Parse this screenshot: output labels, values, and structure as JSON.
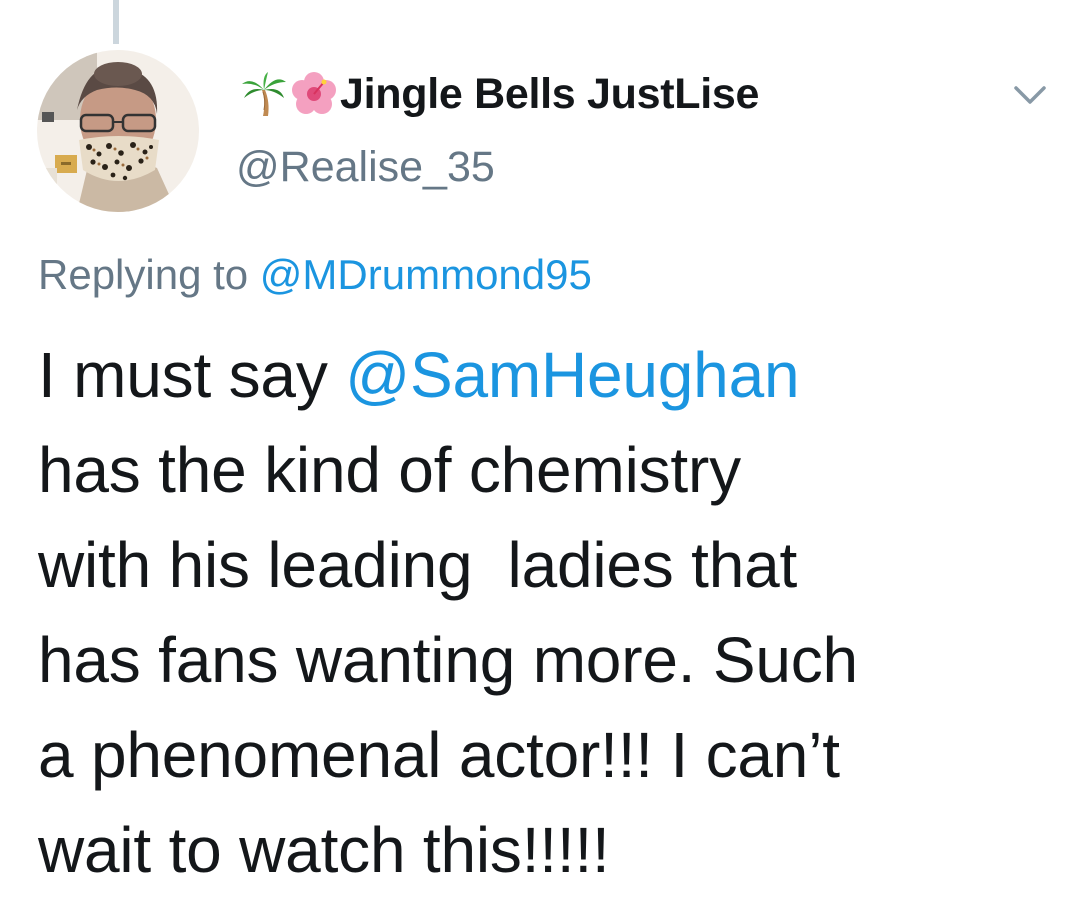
{
  "tweet": {
    "author": {
      "display_name": "Jingle Bells JustLise",
      "name_emojis": [
        "palm-tree-emoji",
        "hibiscus-emoji"
      ],
      "handle": "@Realise_35",
      "avatar": "profile-photo"
    },
    "reply": {
      "prefix": "Replying to",
      "mention": "@MDrummond95"
    },
    "text": {
      "line1_pre": "I must say ",
      "line1_mention": "@SamHeughan",
      "line2": "has the kind of chemistry",
      "line3": "with his leading  ladies that",
      "line4": "has fans wanting more. Such",
      "line5": "a phenomenal actor!!! I can’t",
      "line6": "wait to watch this!!!!!"
    },
    "menu_icon": "chevron-down-icon"
  }
}
